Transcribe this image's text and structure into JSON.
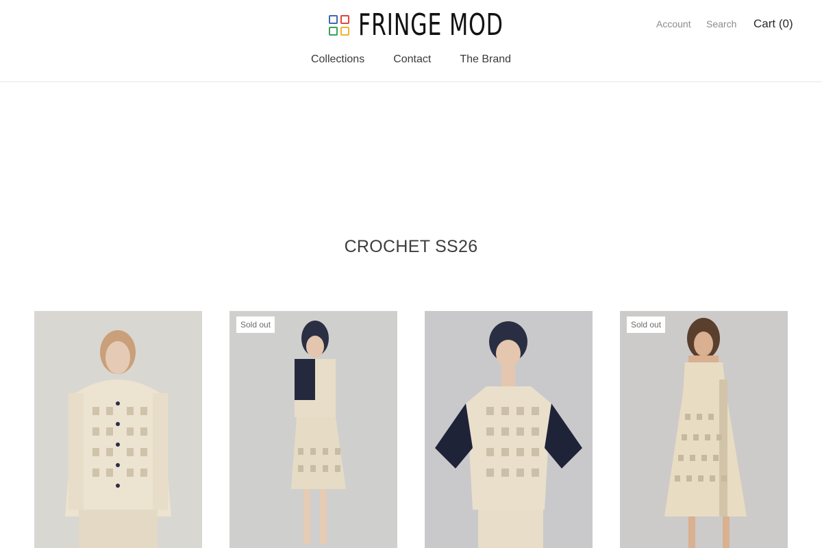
{
  "brand": {
    "name": "FRINGE MOD",
    "logo_colors": [
      "#3a6ab0",
      "#e0463c",
      "#f2b233",
      "#3aa05a"
    ]
  },
  "utility": {
    "account": "Account",
    "search": "Search",
    "cart": "Cart (0)"
  },
  "nav": [
    "Collections",
    "Contact",
    "The Brand"
  ],
  "collection": {
    "title": "CROCHET SS26"
  },
  "products": [
    {
      "badge": "",
      "image": "model in cream crochet button shirt and skirt"
    },
    {
      "badge": "Sold out",
      "image": "model in crochet top with navy sleeves and cream skirt, side view"
    },
    {
      "badge": "",
      "image": "model in navy crochet hat and cream crochet top with navy sleeves"
    },
    {
      "badge": "Sold out",
      "image": "model in cream crochet dress"
    }
  ]
}
